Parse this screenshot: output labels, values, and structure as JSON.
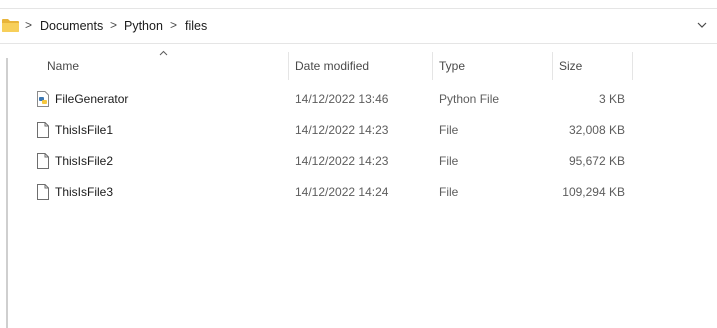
{
  "breadcrumb": {
    "items": [
      "Documents",
      "Python",
      "files"
    ],
    "separator": ">"
  },
  "columns": {
    "name": "Name",
    "date_modified": "Date modified",
    "type": "Type",
    "size": "Size"
  },
  "files": [
    {
      "name": "FileGenerator",
      "date": "14/12/2022 13:46",
      "type": "Python File",
      "size": "3 KB",
      "icon": "python-file-icon"
    },
    {
      "name": "ThisIsFile1",
      "date": "14/12/2022 14:23",
      "type": "File",
      "size": "32,008 KB",
      "icon": "file-icon"
    },
    {
      "name": "ThisIsFile2",
      "date": "14/12/2022 14:23",
      "type": "File",
      "size": "95,672 KB",
      "icon": "file-icon"
    },
    {
      "name": "ThisIsFile3",
      "date": "14/12/2022 14:24",
      "type": "File",
      "size": "109,294 KB",
      "icon": "file-icon"
    }
  ],
  "colors": {
    "folder": "#f0c24b",
    "python_blue": "#3c78b4",
    "python_yellow": "#f6c83e"
  }
}
